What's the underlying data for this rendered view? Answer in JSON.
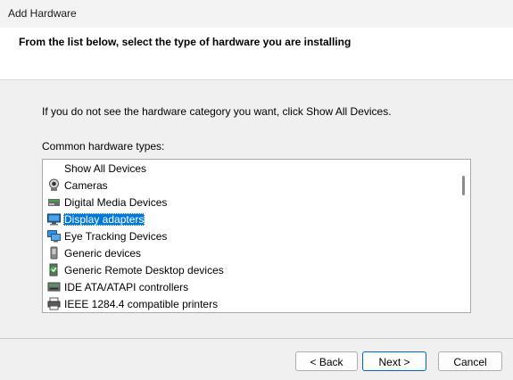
{
  "window": {
    "title": "Add Hardware"
  },
  "header": {
    "instruction": "From the list below, select the type of hardware you are installing"
  },
  "main": {
    "hint": "If you do not see the hardware category you want, click Show All Devices.",
    "list_label": "Common hardware types:",
    "items": [
      {
        "label": "Show All Devices",
        "icon": "none"
      },
      {
        "label": "Cameras",
        "icon": "camera-icon"
      },
      {
        "label": "Digital Media Devices",
        "icon": "media-device-icon"
      },
      {
        "label": "Display adapters",
        "icon": "display-adapter-icon",
        "selected": true
      },
      {
        "label": "Eye Tracking Devices",
        "icon": "eye-tracking-icon"
      },
      {
        "label": "Generic devices",
        "icon": "generic-device-icon"
      },
      {
        "label": "Generic Remote Desktop devices",
        "icon": "remote-desktop-icon"
      },
      {
        "label": "IDE ATA/ATAPI controllers",
        "icon": "ide-controller-icon"
      },
      {
        "label": "IEEE 1284.4 compatible printers",
        "icon": "printer-icon"
      }
    ],
    "selection_color": "#0078d7"
  },
  "footer": {
    "back_label": "< Back",
    "next_label": "Next >",
    "cancel_label": "Cancel"
  }
}
